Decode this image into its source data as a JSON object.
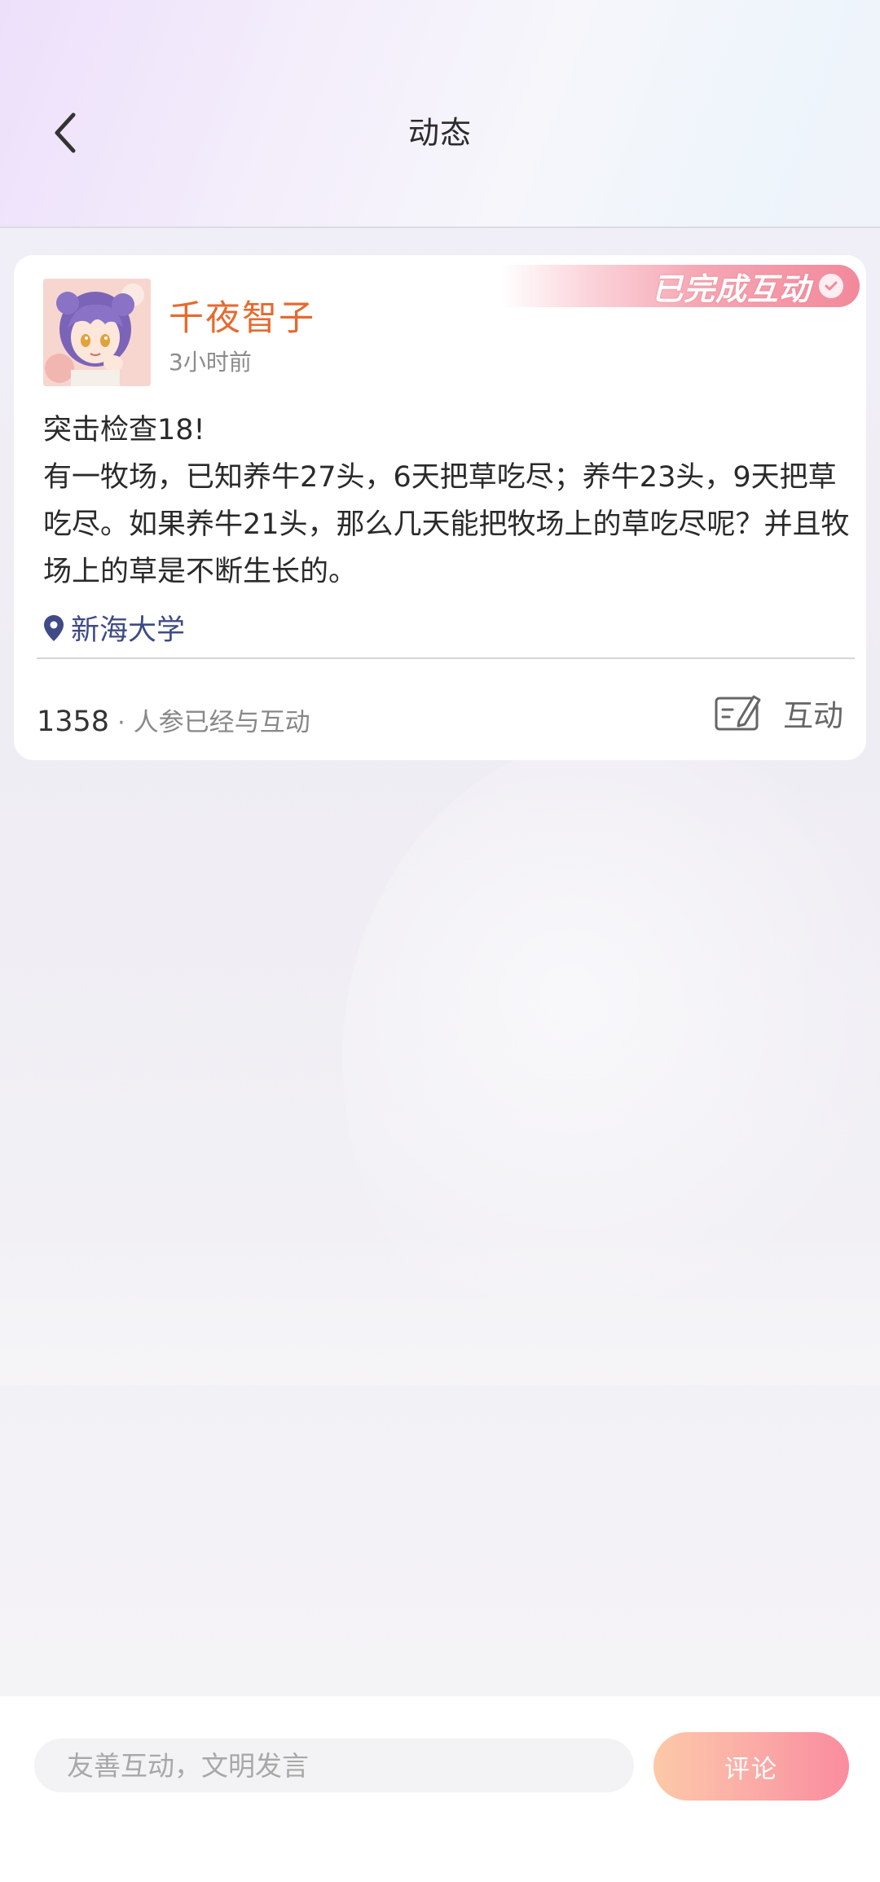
{
  "header": {
    "title": "动态",
    "back_icon": "chevron-left-icon"
  },
  "post": {
    "badge_text": "已完成互动",
    "author": {
      "name": "千夜智子",
      "avatar": "anime-girl-avatar"
    },
    "time": "3小时前",
    "content": "突击检查18!\n有一牧场，已知养牛27头，6天把草吃尽；养牛23头，9天把草吃尽。如果养牛21头，那么几天能把牧场上的草吃尽呢？并且牧场上的草是不断生长的。",
    "location": "新海大学",
    "participant_count": "1358",
    "participant_label": "人参已经与互动",
    "interact_label": "互动"
  },
  "comment_bar": {
    "placeholder": "友善互动，文明发言",
    "submit_label": "评论"
  },
  "colors": {
    "username": "#e56a2f",
    "location": "#3f4a87",
    "submit_gradient_start": "#fcc099",
    "submit_gradient_end": "#f9788e",
    "badge": "#f2899b"
  }
}
